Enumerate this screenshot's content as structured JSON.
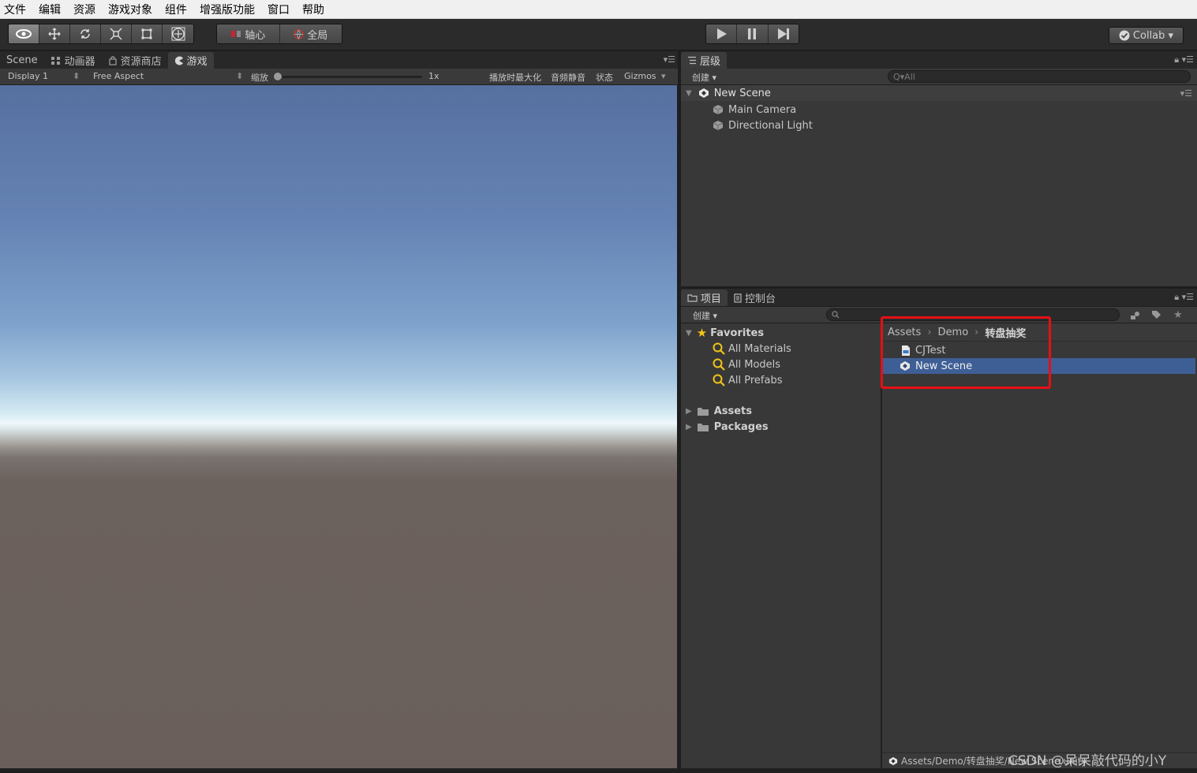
{
  "menu": [
    "文件",
    "编辑",
    "资源",
    "游戏对象",
    "组件",
    "增强版功能",
    "窗口",
    "帮助"
  ],
  "toolbar": {
    "transform_tools": [
      "view-tool",
      "move-tool",
      "rotate-tool",
      "scale-tool",
      "rect-tool",
      "transform-tool"
    ],
    "pivot_label": "轴心",
    "global_label": "全局",
    "collab_label": "Collab ▾"
  },
  "game_panel": {
    "tabs": [
      "Scene",
      "动画器",
      "资源商店",
      "游戏"
    ],
    "active_tab": "游戏",
    "display": "Display 1",
    "aspect": "Free Aspect",
    "scale_label": "缩放",
    "scale_value": "1x",
    "maximize_label": "播放时最大化",
    "mute_label": "音频静音",
    "stats_label": "状态",
    "gizmos_label": "Gizmos"
  },
  "hierarchy": {
    "tab": "层级",
    "create_label": "创建 ▾",
    "search_placeholder": "Q▾All",
    "scene_name": "New Scene",
    "objects": [
      "Main Camera",
      "Directional Light"
    ]
  },
  "project": {
    "tabs": [
      "项目",
      "控制台"
    ],
    "create_label": "创建 ▾",
    "favorites_label": "Favorites",
    "favorites": [
      "All Materials",
      "All Models",
      "All Prefabs"
    ],
    "roots": [
      "Assets",
      "Packages"
    ],
    "breadcrumb": [
      "Assets",
      "Demo",
      "转盘抽奖"
    ],
    "files": [
      {
        "name": "CJTest",
        "type": "cs-script-icon",
        "selected": false
      },
      {
        "name": "New Scene",
        "type": "unity-scene-icon",
        "selected": true
      }
    ],
    "status_path": "Assets/Demo/转盘抽奖/New Scene.unity"
  },
  "watermark": "CSDN @呆呆敲代码的小Y",
  "colors": {
    "selection": "#3e5f96",
    "highlight_box": "#e60f14",
    "panel_bg": "#383838"
  }
}
